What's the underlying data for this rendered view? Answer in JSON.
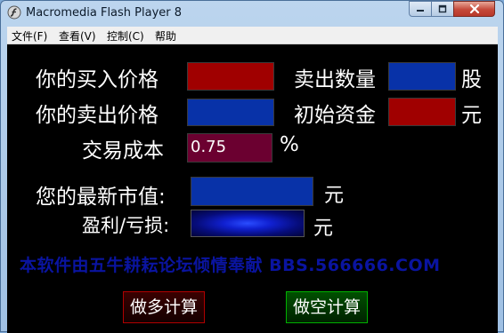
{
  "window": {
    "title": "Macromedia Flash Player 8"
  },
  "menu": {
    "file": "文件(F)",
    "view": "查看(V)",
    "control": "控制(C)",
    "help": "帮助"
  },
  "form": {
    "buy_price_label": "你的买入价格",
    "buy_price_value": "",
    "sell_qty_label": "卖出数量",
    "sell_qty_value": "",
    "sell_qty_unit": "股",
    "sell_price_label": "你的卖出价格",
    "sell_price_value": "",
    "initial_capital_label": "初始资金",
    "initial_capital_value": "",
    "initial_capital_unit": "元",
    "trade_cost_label": "交易成本",
    "trade_cost_value": "0.75",
    "trade_cost_unit": "%",
    "market_value_label": "您的最新市值:",
    "market_value_value": "",
    "market_value_unit": "元",
    "profit_loss_label": "盈利/亏损:",
    "profit_loss_value": "",
    "profit_loss_unit": "元"
  },
  "watermark": "本软件由五牛耕耘论坛倾情奉献  BBS.566666.COM",
  "buttons": {
    "long": "做多计算",
    "short": "做空计算"
  },
  "colors": {
    "red_box": "#a00000",
    "blue_box": "#0832a8",
    "maroon_box": "#6b0030",
    "stage_bg": "#000000"
  }
}
